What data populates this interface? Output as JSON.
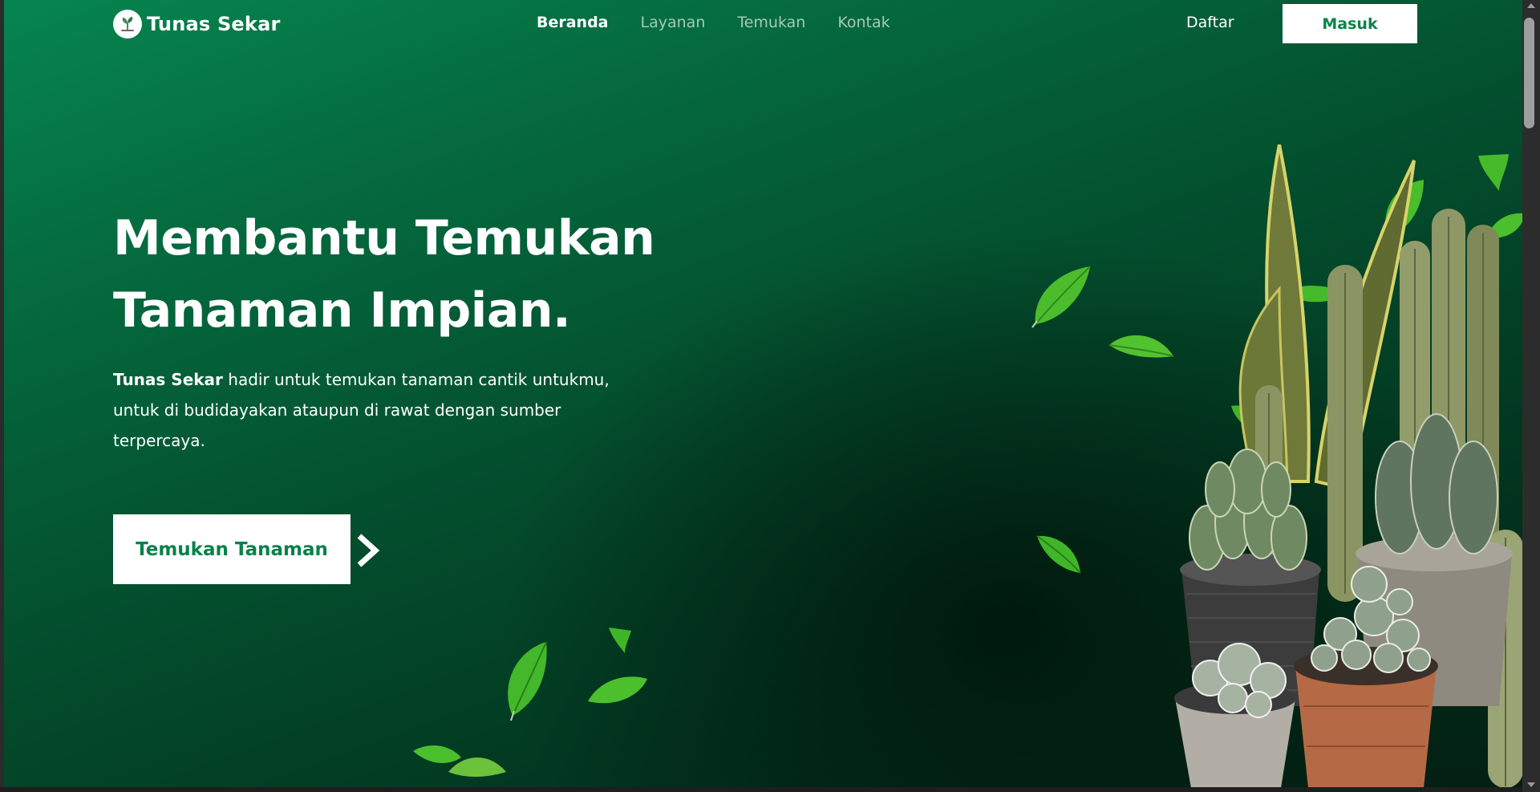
{
  "brand": {
    "name": "Tunas Sekar",
    "logo_icon": "seedling-logo"
  },
  "nav": {
    "items": [
      {
        "label": "Beranda",
        "active": true
      },
      {
        "label": "Layanan",
        "active": false
      },
      {
        "label": "Temukan",
        "active": false
      },
      {
        "label": "Kontak",
        "active": false
      }
    ],
    "register_label": "Daftar",
    "login_label": "Masuk"
  },
  "hero": {
    "headline_line1": "Membantu Temukan",
    "headline_line2": "Tanaman Impian.",
    "description_brand": "Tunas Sekar",
    "description_rest": " hadir untuk temukan tanaman cantik untukmu, untuk di budidayakan ataupun di rawat dengan sumber terpercaya.",
    "cta_label": "Temukan Tanaman",
    "cta_icon": "chevron-right-icon"
  },
  "colors": {
    "brand_green": "#0a8349",
    "background_dark": "#021f13",
    "background_light": "#068550",
    "nav_inactive": "#a7c9b6"
  }
}
